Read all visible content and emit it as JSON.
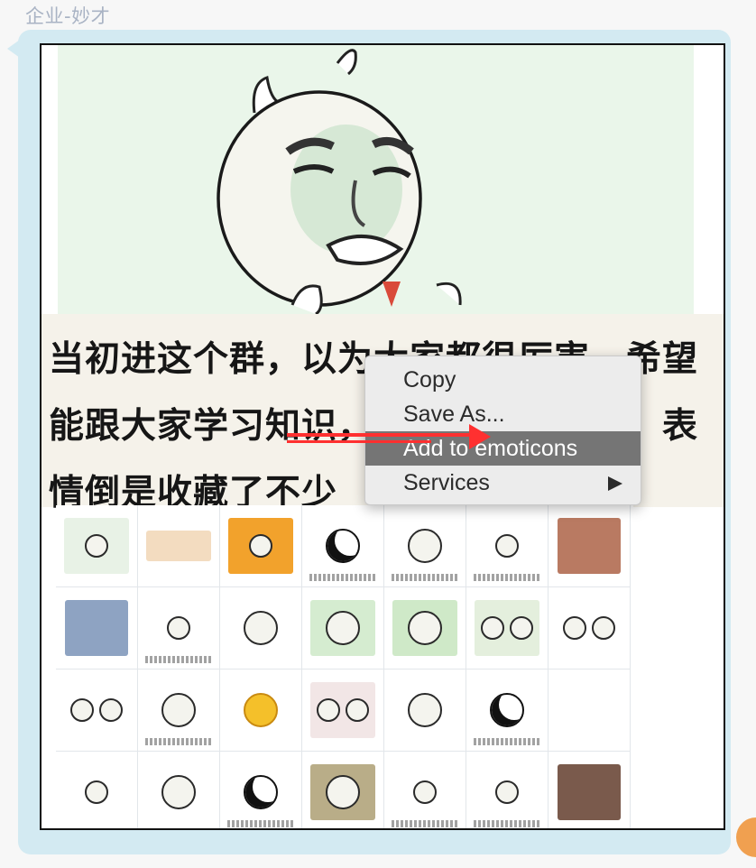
{
  "sender_name": "企业-妙才",
  "meme": {
    "caption": "当初进这个群，以为大家都很厉害，希望能跟大家学习知识，结果啥也没学到，表情倒是收藏了不少"
  },
  "context_menu": {
    "items": [
      {
        "label": "Copy"
      },
      {
        "label": "Save As..."
      },
      {
        "label": "Add to emoticons"
      },
      {
        "label": "Services"
      }
    ]
  },
  "colors": {
    "bubble": "#d3eaf2",
    "menu_highlight": "#757575",
    "annotation_arrow": "#ff3030",
    "sender_name": "#a9b3c4"
  }
}
